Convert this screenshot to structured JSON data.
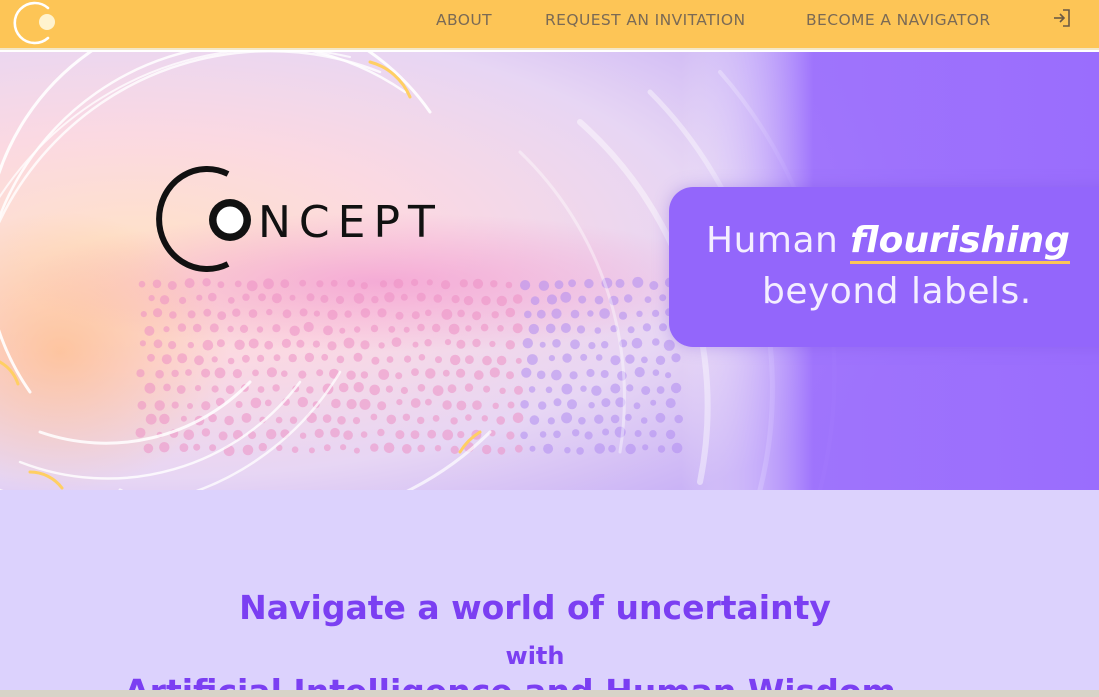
{
  "nav": {
    "logo_icon": "concept-c-logo-icon",
    "links": [
      {
        "label": "ABOUT"
      },
      {
        "label": "REQUEST AN INVITATION"
      },
      {
        "label": "BECOME A NAVIGATOR"
      }
    ],
    "login_icon": "login-arrow-icon"
  },
  "hero": {
    "brand_name": "CONCEPT",
    "tagline_word1": "Human",
    "tagline_highlight": "flourishing",
    "tagline_line2": "beyond labels."
  },
  "intro": {
    "heading": "Navigate a world of uncertainty",
    "connector": "with",
    "line3": "Artificial Intelligence and Human Wisdom"
  },
  "colors": {
    "nav_bg": "#fdc556",
    "hero_purple": "#9366fb",
    "heading_purple": "#7b3ff2",
    "section_bg": "#dcd2fd",
    "accent_yellow": "#fdc556"
  }
}
